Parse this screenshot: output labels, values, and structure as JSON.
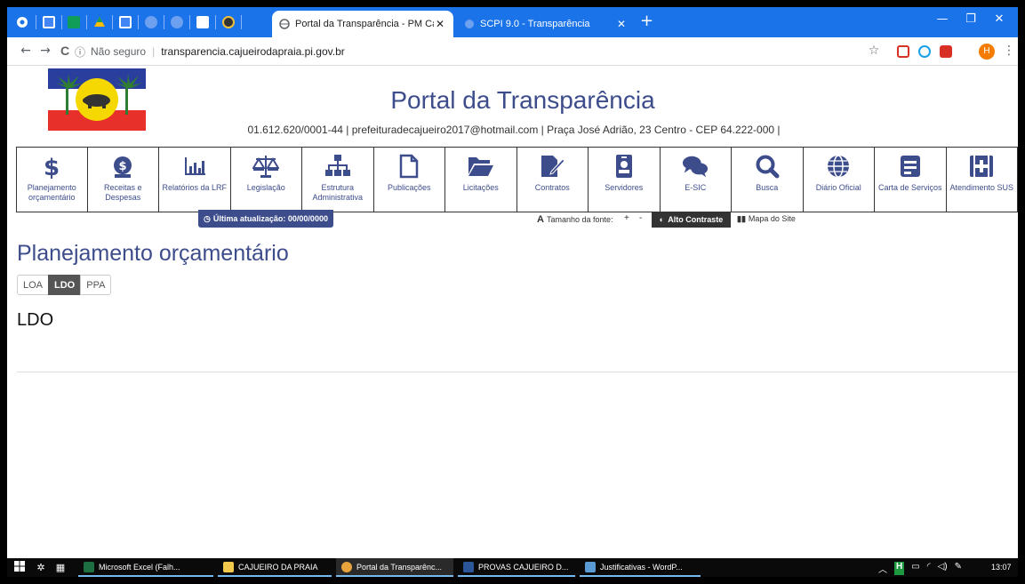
{
  "browser": {
    "tabs": [
      {
        "title": "Portal da Transparência - PM Caj",
        "active": true
      },
      {
        "title": "SCPI 9.0 - Transparência",
        "active": false
      }
    ],
    "new_tab": "+",
    "minimize": "—",
    "maximize": "❐",
    "close": "✕",
    "tab_close": "✕",
    "address": {
      "security": "Não seguro",
      "host": "transparencia.cajueirodapraia.pi.gov.br"
    },
    "back": "←",
    "forward": "→",
    "reload": "C",
    "star": "☆",
    "profile_initial": "H",
    "menu": "⋮"
  },
  "header": {
    "title": "Portal da Transparência",
    "contact": "01.612.620/0001-44 | prefeituradecajueiro2017@hotmail.com | Praça José Adrião, 23 Centro - CEP 64.222-000 |"
  },
  "menu": {
    "items": [
      {
        "label": "Planejamento orçamentário",
        "icon": "dollar-icon"
      },
      {
        "label": "Receitas e Despesas",
        "icon": "money-bag-icon"
      },
      {
        "label": "Relatórios da LRF",
        "icon": "bar-chart-icon"
      },
      {
        "label": "Legislação",
        "icon": "scales-icon"
      },
      {
        "label": "Estrutura Administrativa",
        "icon": "org-chart-icon"
      },
      {
        "label": "Publicações",
        "icon": "file-icon"
      },
      {
        "label": "Licitações",
        "icon": "folder-open-icon"
      },
      {
        "label": "Contratos",
        "icon": "file-signature-icon"
      },
      {
        "label": "Servidores",
        "icon": "id-badge-icon"
      },
      {
        "label": "E-SIC",
        "icon": "comments-icon"
      },
      {
        "label": "Busca",
        "icon": "search-icon"
      },
      {
        "label": "Diário Oficial",
        "icon": "globe-icon"
      },
      {
        "label": "Carta de Serviços",
        "icon": "document-list-icon"
      },
      {
        "label": "Atendimento SUS",
        "icon": "medical-plus-icon"
      }
    ]
  },
  "toolbar": {
    "last_update": "Última atualização: 00/00/0000",
    "font_size_icon": "A",
    "font_size_label": "Tamanho da fonte:",
    "font_increase": "+",
    "font_decrease": "-",
    "contrast": "Alto Contraste",
    "sitemap": "Mapa do Site"
  },
  "page": {
    "title": "Planejamento orçamentário",
    "tabs": [
      "LOA",
      "LDO",
      "PPA"
    ],
    "active_tab": "LDO",
    "section_heading": "LDO"
  },
  "taskbar": {
    "apps": [
      "Microsoft Excel (Falh...",
      "CAJUEIRO DA PRAIA",
      "Portal da Transparênc...",
      "PROVAS CAJUEIRO D...",
      "Justificativas - WordP..."
    ],
    "time": "13:07"
  },
  "colors": {
    "brand": "#3d4d8c",
    "chrome": "#1a73e8",
    "taskbar": "#0a0a0a"
  }
}
